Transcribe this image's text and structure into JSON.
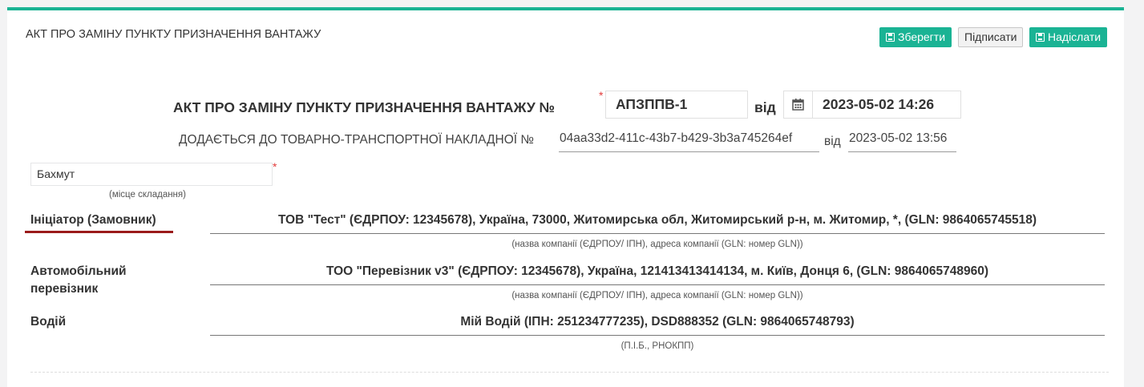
{
  "panel": {
    "title": "АКТ ПРО ЗАМІНУ ПУНКТУ ПРИЗНАЧЕННЯ ВАНТАЖУ"
  },
  "toolbar": {
    "save_label": "Зберегти",
    "sign_label": "Підписати",
    "send_label": "Надіслати"
  },
  "act": {
    "title": "АКТ ПРО ЗАМІНУ ПУНКТУ ПРИЗНАЧЕННЯ ВАНТАЖУ №",
    "required_mark": "*",
    "number": "АПЗППВ-1",
    "from_label": "від",
    "date": "2023-05-02 14:26"
  },
  "ttn": {
    "prefix": "ДОДАЄТЬСЯ ДО ТОВАРНО-ТРАНСПОРТНОЇ НАКЛАДНОЇ №",
    "number": "04aa33d2-411c-43b7-b429-3b3a745264ef",
    "from_label": "від",
    "date": "2023-05-02 13:56"
  },
  "place": {
    "value": "Бахмут",
    "required_mark": "*",
    "hint": "(місце складання)"
  },
  "initiator": {
    "label": "Ініціатор (Замовник)",
    "value": "ТОВ \"Тест\" (ЄДРПОУ: 12345678), Україна, 73000, Житомирська обл, Житомирський р-н, м. Житомир, *, (GLN: 9864065745518)",
    "hint": "(назва компанії (ЄДРПОУ/ ІПН), адреса компанії (GLN: номер GLN))"
  },
  "carrier": {
    "label_line1": "Автомобільний",
    "label_line2": "перевізник",
    "value": "ТОО \"Перевізник v3\" (ЄДРПОУ: 12345678), Україна, 121413413414134, м. Київ, Донця 6, (GLN: 9864065748960)",
    "hint": "(назва компанії (ЄДРПОУ/ ІПН), адреса компанії (GLN: номер GLN))"
  },
  "driver": {
    "label": "Водій",
    "value": "Мій Водій (ІПН: 251234777235), DSD888352 (GLN: 9864065748793)",
    "hint": "(П.І.Б., РНОКПП)"
  },
  "colors": {
    "accent": "#1ab394",
    "required": "#e23b3b",
    "active_underline": "#9b1b1b"
  },
  "icons": {
    "save": "floppy-disk-icon",
    "calendar": "calendar-icon"
  }
}
